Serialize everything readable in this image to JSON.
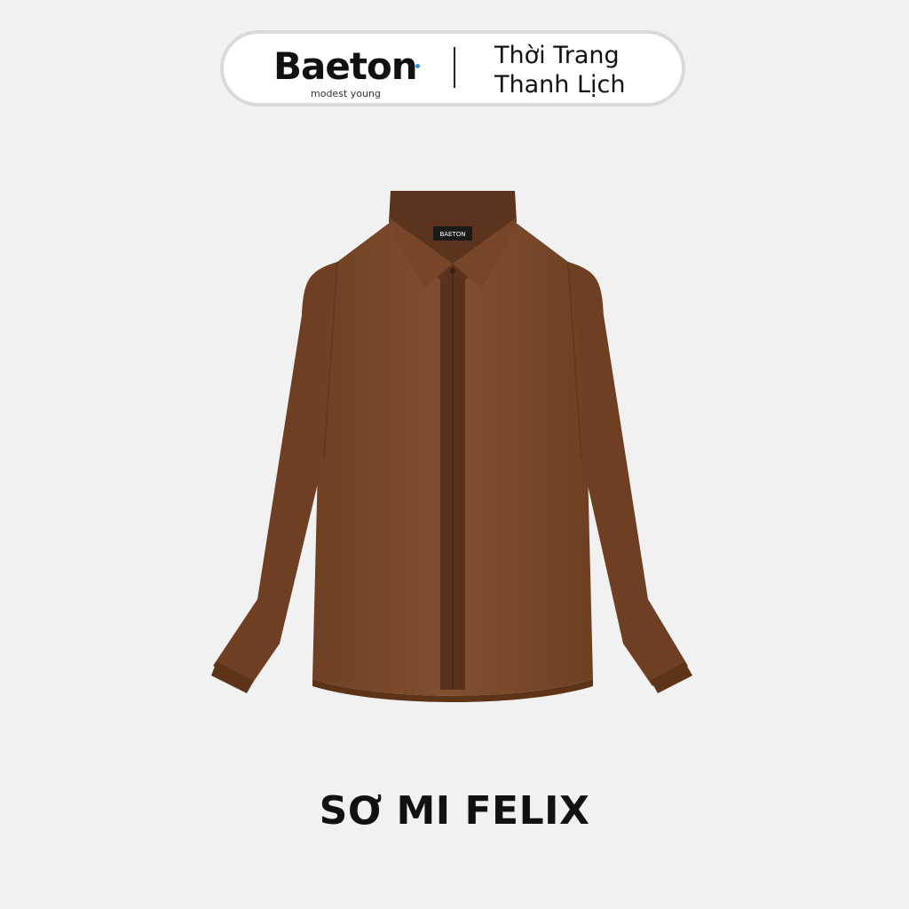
{
  "header": {
    "logo": {
      "name": "Baeton",
      "tagline": "modest young",
      "dot_color": "#2a8fd6"
    },
    "slogan_lines": [
      "Thời Trang",
      "Thanh Lịch"
    ]
  },
  "product": {
    "image_icon": "brown-long-sleeve-shirt",
    "shirt_color": "#7e4a2b",
    "collar_label": "BAETON",
    "name": "SƠ MI FELIX"
  },
  "colors": {
    "background": "#f2f1f1",
    "pill_fill": "#ffffff",
    "pill_border": "#dadada",
    "text": "#111111"
  }
}
